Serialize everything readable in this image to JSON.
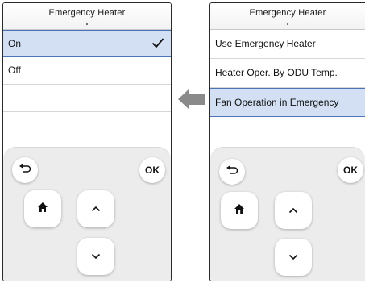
{
  "left_screen": {
    "title": "Emergency Heater",
    "items": [
      {
        "label": "On",
        "selected": true
      },
      {
        "label": "Off",
        "selected": false
      }
    ],
    "controls": {
      "back_icon": "back-arrow-icon",
      "ok_label": "OK",
      "home_icon": "home-icon",
      "up_icon": "chevron-up-icon",
      "down_icon": "chevron-down-icon"
    }
  },
  "right_screen": {
    "title": "Emergency Heater",
    "items": [
      {
        "label": "Use Emergency Heater",
        "selected": false
      },
      {
        "label": "Heater Oper. By ODU Temp.",
        "selected": false
      },
      {
        "label": "Fan Operation in Emergency",
        "selected": true
      }
    ],
    "controls": {
      "back_icon": "back-arrow-icon",
      "ok_label": "OK",
      "home_icon": "home-icon",
      "up_icon": "chevron-up-icon",
      "down_icon": "chevron-down-icon"
    }
  },
  "colors": {
    "selected_row": "#d3e0f4",
    "selected_border": "#4c75b8",
    "panel": "#ececec",
    "arrow": "#8a8a8a"
  }
}
